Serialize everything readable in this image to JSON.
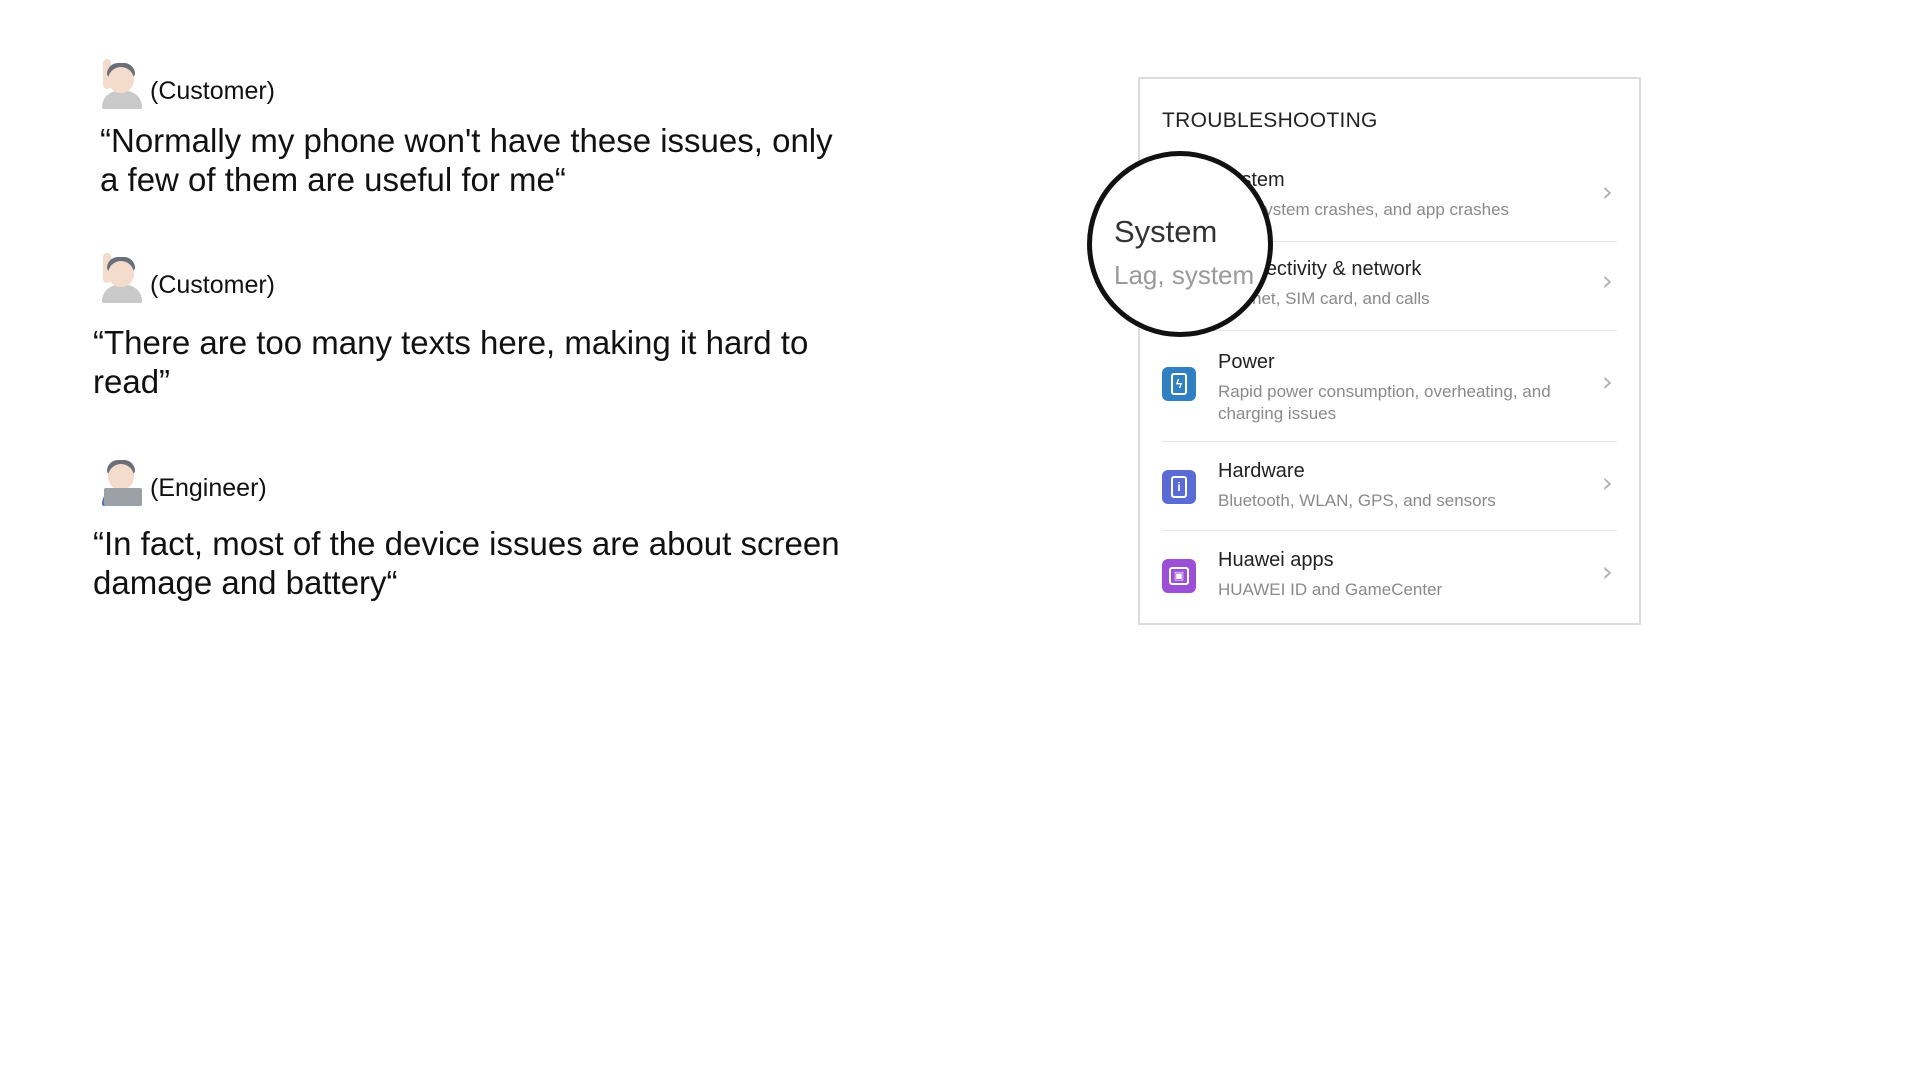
{
  "quotes": [
    {
      "speaker": "(Customer)",
      "text": "“Normally my phone won't have these issues, only a few of them are useful for me“"
    },
    {
      "speaker": "(Customer)",
      "text": "“There are too many texts here, making it hard to read”"
    },
    {
      "speaker": "(Engineer)",
      "text": "“In fact, most of the device issues are about screen damage and battery“"
    }
  ],
  "panel": {
    "title": "TROUBLESHOOTING",
    "items": [
      {
        "title": "System",
        "subtitle": "Lag, system crashes, and app crashes",
        "icon": "system-icon",
        "color": "#ffffff"
      },
      {
        "title": "Connectivity & network",
        "subtitle": "Internet, SIM card, and calls",
        "icon": "network-icon",
        "color": "#ffffff"
      },
      {
        "title": "Power",
        "subtitle": "Rapid power consumption, overheating, and charging issues",
        "icon": "battery-icon",
        "color": "#2f7fc1"
      },
      {
        "title": "Hardware",
        "subtitle": "Bluetooth, WLAN, GPS, and sensors",
        "icon": "hardware-icon",
        "color": "#5b6bd6"
      },
      {
        "title": "Huawei apps",
        "subtitle": "HUAWEI ID and GameCenter",
        "icon": "apps-icon",
        "color": "#9b4fd6"
      }
    ]
  },
  "magnifier": {
    "title": "System",
    "subtitle": "Lag, system crashes"
  }
}
